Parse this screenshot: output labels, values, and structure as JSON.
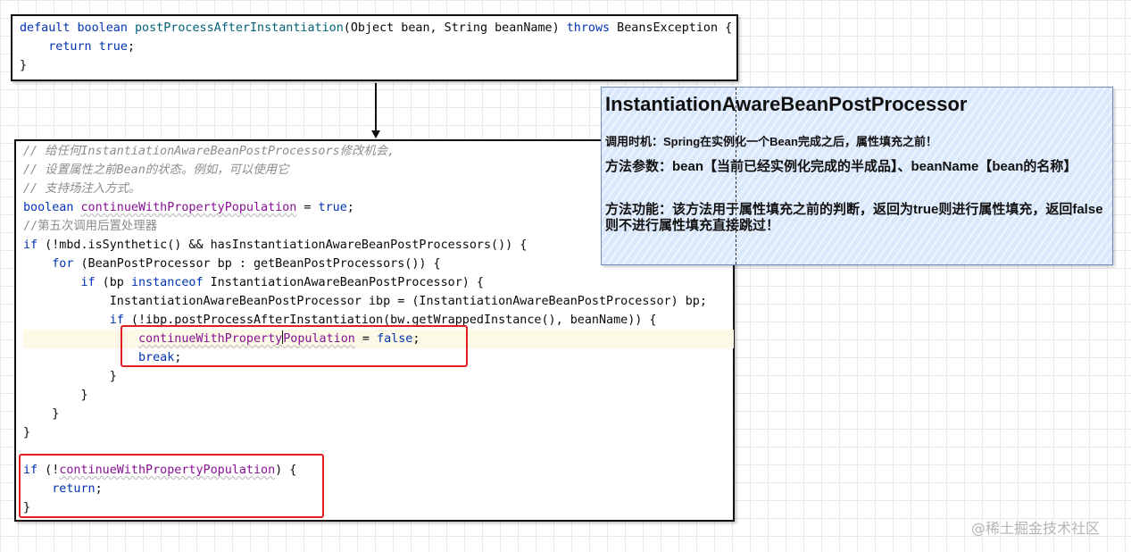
{
  "top_code": {
    "l1": {
      "kw1": "default",
      "sp1": " ",
      "kw2": "boolean",
      "sp2": " ",
      "fn": "postProcessAfterInstantiation",
      "p1": "(Object bean, String beanName) ",
      "kw3": "throws",
      "p2": " BeansException {"
    },
    "l2": {
      "indent": "    ",
      "kw": "return",
      "sp": " ",
      "val": "true",
      "end": ";"
    },
    "l3": "}"
  },
  "main_code": {
    "c1": "// 给任何InstantiationAwareBeanPostProcessors修改机会,",
    "c2": "// 设置属性之前Bean的状态。例如，可以使用它",
    "c3": "// 支持场注入方式。",
    "l4": {
      "kw": "boolean",
      "sp": " ",
      "var": "continueWithPropertyPopulation",
      "eq": " = ",
      "val": "true",
      "end": ";"
    },
    "c5": "//第五次调用后置处理器",
    "l6": {
      "kw": "if",
      "rest": " (!mbd.isSynthetic() && hasInstantiationAwareBeanPostProcessors()) {"
    },
    "l7": {
      "indent": "    ",
      "kw": "for",
      "rest": " (BeanPostProcessor bp : getBeanPostProcessors()) {"
    },
    "l8": {
      "indent": "        ",
      "kw": "if",
      "p1": " (bp ",
      "kw2": "instanceof",
      "p2": " InstantiationAwareBeanPostProcessor) {"
    },
    "l9": "            InstantiationAwareBeanPostProcessor ibp = (InstantiationAwareBeanPostProcessor) bp;",
    "l10": {
      "indent": "            ",
      "kw": "if",
      "rest": " (!ibp.postProcessAfterInstantiation(bw.getWrappedInstance(), beanName)) {"
    },
    "l11": {
      "indent": "                ",
      "var_a": "continueWithProperty",
      "var_b": "Population",
      "eq": " = ",
      "val": "false",
      "end": ";"
    },
    "l12": {
      "indent": "                ",
      "kw": "break",
      "end": ";"
    },
    "l13": "            }",
    "l14": "        }",
    "l15": "    }",
    "l16": "}",
    "l18": {
      "kw": "if",
      "p1": " (!",
      "var": "continueWithPropertyPopulation",
      "p2": ") {"
    },
    "l19": {
      "indent": "    ",
      "kw": "return",
      "end": ";"
    },
    "l20": "}"
  },
  "note": {
    "title": "InstantiationAwareBeanPostProcessor",
    "timing": "调用时机：Spring在实例化一个Bean完成之后，属性填充之前！",
    "params": "方法参数：bean【当前已经实例化完成的半成品】、beanName【bean的名称】",
    "function": "方法功能：该方法用于属性填充之前的判断，返回为true则进行属性填充，返回false则不进行属性填充直接跳过！"
  },
  "watermark": "@稀土掘金技术社区",
  "colors": {
    "keyword": "#0033b3",
    "method": "#00627a",
    "comment": "#8c8c8c",
    "field": "#871094",
    "highlight": "#e02020",
    "note_fill": "#dae8fc",
    "note_border": "#6c8ebf"
  }
}
